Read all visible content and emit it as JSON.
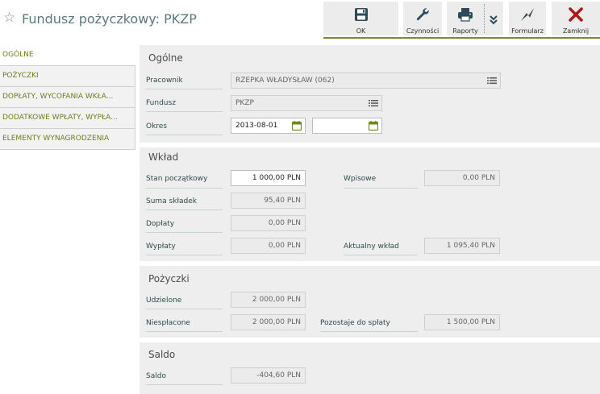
{
  "header": {
    "title": "Fundusz pożyczkowy: PKZP",
    "toolbar": {
      "ok": "OK",
      "czynnosci": "Czynności",
      "raporty": "Raporty",
      "formularz": "Formularz",
      "zamknij": "Zamknij"
    }
  },
  "nav": {
    "items": [
      {
        "label": "OGÓLNE"
      },
      {
        "label": "POŻYCZKI"
      },
      {
        "label": "DOPŁATY, WYCOFANIA WKŁA..."
      },
      {
        "label": "DODATKOWE WPŁATY, WYPŁA..."
      },
      {
        "label": "ELEMENTY WYNAGRODZENIA"
      }
    ]
  },
  "ogolne": {
    "title": "Ogólne",
    "pracownik_label": "Pracownik",
    "pracownik_value": "RZEPKA WŁADYSŁAW (062)",
    "fundusz_label": "Fundusz",
    "fundusz_value": "PKZP",
    "okres_label": "Okres",
    "okres_from": "2013-08-01",
    "okres_to": ""
  },
  "wklad": {
    "title": "Wkład",
    "stan_label": "Stan początkowy",
    "stan_value": "1 000,00 PLN",
    "suma_label": "Suma składek",
    "suma_value": "95,40 PLN",
    "doplaty_label": "Dopłaty",
    "doplaty_value": "0,00 PLN",
    "wyplaty_label": "Wypłaty",
    "wyplaty_value": "0,00 PLN",
    "wpisowe_label": "Wpisowe",
    "wpisowe_value": "0,00 PLN",
    "aktualny_label": "Aktualny wkład",
    "aktualny_value": "1 095,40 PLN"
  },
  "pozyczki": {
    "title": "Pożyczki",
    "udzielone_label": "Udzielone",
    "udzielone_value": "2 000,00 PLN",
    "niesplacone_label": "Niespłacone",
    "niesplacone_value": "2 000,00 PLN",
    "pozostaje_label": "Pozostaje do spłaty",
    "pozostaje_value": "1 500,00 PLN"
  },
  "saldo": {
    "title": "Saldo",
    "saldo_label": "Saldo",
    "saldo_value": "-404,60 PLN"
  },
  "colors": {
    "accent": "#6d7d1e",
    "title": "#5b7a7a",
    "close": "#b01818",
    "toolbar_icon": "#2e4a5a"
  }
}
